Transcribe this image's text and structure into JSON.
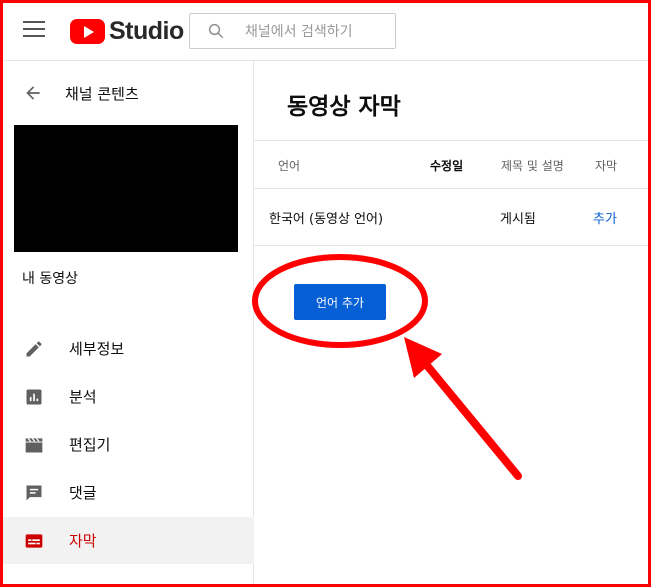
{
  "header": {
    "logo_text": "Studio",
    "search_placeholder": "채널에서 검색하기"
  },
  "sidebar": {
    "back_label": "채널 콘텐츠",
    "video_label": "내 동영상",
    "items": [
      {
        "label": "세부정보",
        "icon": "pencil-icon"
      },
      {
        "label": "분석",
        "icon": "analytics-icon"
      },
      {
        "label": "편집기",
        "icon": "clapperboard-icon"
      },
      {
        "label": "댓글",
        "icon": "comment-icon"
      },
      {
        "label": "자막",
        "icon": "subtitles-icon",
        "active": true
      }
    ]
  },
  "main": {
    "title": "동영상 자막",
    "columns": [
      "언어",
      "수정일",
      "제목 및 설명",
      "자막"
    ],
    "row": {
      "language": "한국어 (동영상 언어)",
      "modified": "",
      "title_desc": "게시됨",
      "subtitles": "추가"
    },
    "add_language_button": "언어 추가"
  },
  "colors": {
    "brand_red": "#ff0000",
    "accent_blue": "#065fd4",
    "active_red": "#cc0000",
    "annotation_red": "#ff0000"
  }
}
